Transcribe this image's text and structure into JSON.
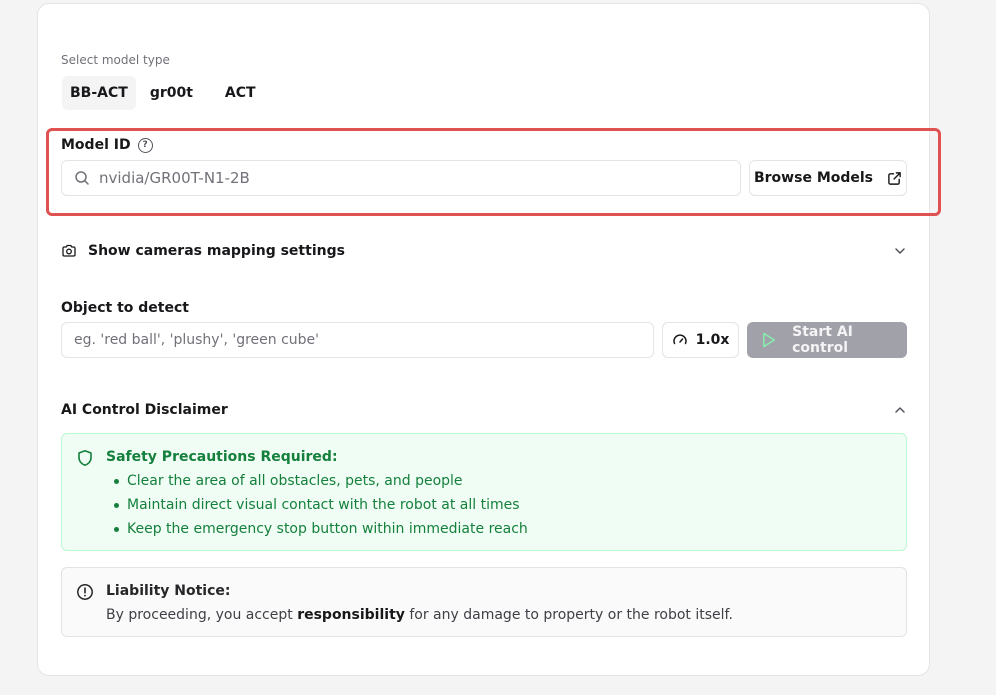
{
  "model_type": {
    "label": "Select model type",
    "tabs": [
      {
        "label": "BB-ACT",
        "active": true
      },
      {
        "label": "gr00t",
        "active": false
      },
      {
        "label": "ACT",
        "active": false
      }
    ]
  },
  "model_id": {
    "label": "Model ID",
    "help_icon": "?",
    "value": "nvidia/GR00T-N1-2B",
    "browse_label": "Browse Models"
  },
  "cameras": {
    "label": "Show cameras mapping settings"
  },
  "object_detect": {
    "label": "Object to detect",
    "placeholder": "eg. 'red ball', 'plushy', 'green cube'",
    "speed_label": "1.0x",
    "start_label": "Start AI control"
  },
  "disclaimer": {
    "title": "AI Control Disclaimer",
    "safety_title": "Safety Precautions Required:",
    "safety_items": [
      "Clear the area of all obstacles, pets, and people",
      "Maintain direct visual contact with the robot at all times",
      "Keep the emergency stop button within immediate reach"
    ],
    "liability_title": "Liability Notice:",
    "liability_before": "By proceeding, you accept ",
    "liability_bold": "responsibility",
    "liability_after": " for any damage to property or the robot itself."
  },
  "colors": {
    "highlight": "#e05252",
    "safety_green": "#15803d",
    "safety_bg": "#f0fdf4",
    "disabled_button": "#a1a1aa"
  },
  "icons": {
    "model_search": "search-icon",
    "browse": "external-link-icon",
    "cameras": "camera-icon",
    "cameras_toggle": "chevron-down-icon",
    "speed": "gauge-icon",
    "start": "play-icon",
    "disclaimer_toggle": "chevron-up-icon",
    "safety": "shield-icon",
    "liability": "alert-circle-icon"
  }
}
